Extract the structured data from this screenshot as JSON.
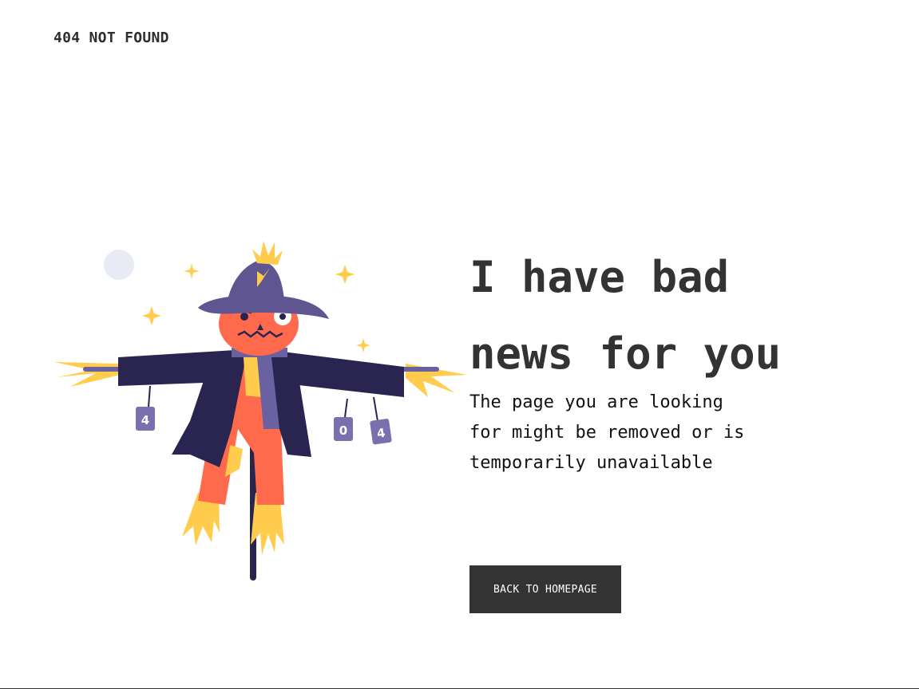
{
  "header": {
    "brand": "404 NOT FOUND"
  },
  "main": {
    "headline_line1": "I have bad",
    "headline_line2": "news for you",
    "message": "The page you are looking for might be removed or is temporarily unavailable",
    "button_label": "BACK TO HOMEPAGE"
  },
  "illustration": {
    "subject": "scarecrow",
    "can_labels": [
      "4",
      "0",
      "4"
    ],
    "colors": {
      "hat": "#5e5591",
      "coat": "#2a2550",
      "face": "#ff6a4d",
      "straw": "#ffcc4d",
      "scarf": "#6a62a0",
      "moon": "#e8ebf5"
    }
  },
  "colors": {
    "button_bg": "#333333",
    "button_text": "#ffffff",
    "text": "#333333"
  }
}
